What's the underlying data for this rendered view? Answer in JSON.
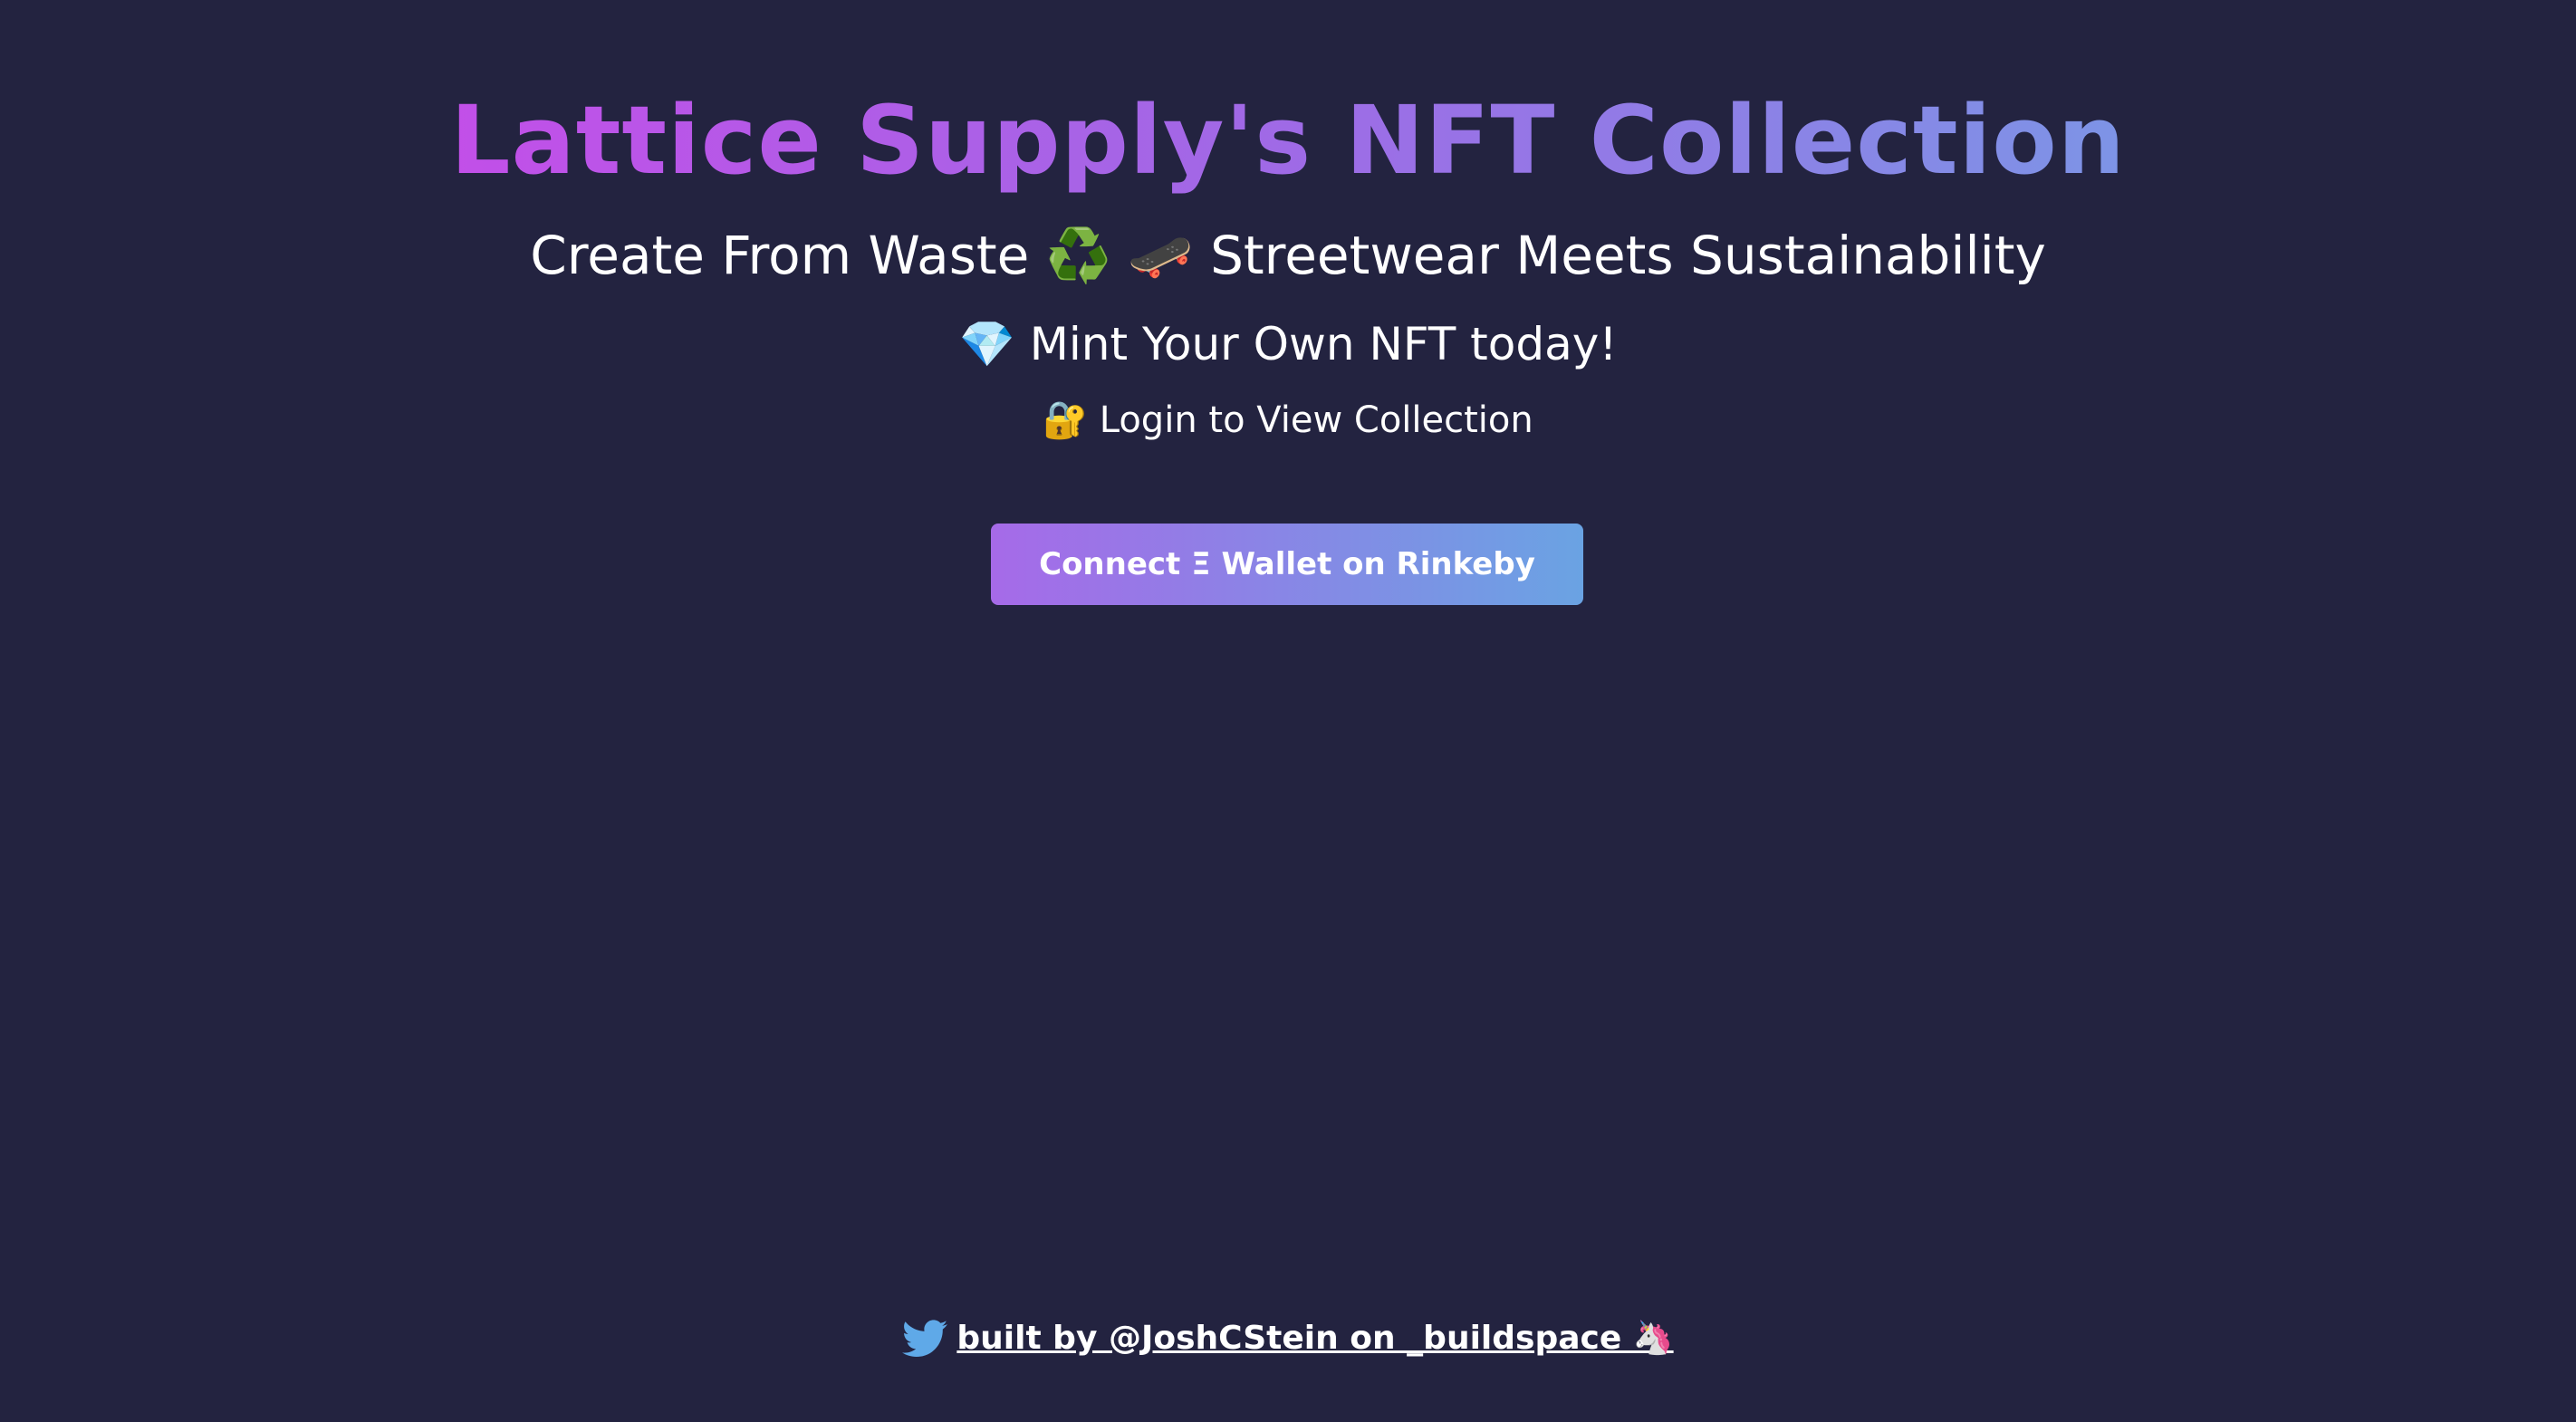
{
  "header": {
    "title": "Lattice Supply's NFT Collection",
    "subtitle": "Create From Waste ♻️ 🛹 Streetwear Meets Sustainability",
    "mint_text": "💎 Mint Your Own NFT today!",
    "login_text": "🔐 Login to View Collection"
  },
  "actions": {
    "connect_label": "Connect Ξ Wallet on Rinkeby"
  },
  "footer": {
    "icon": "twitter-icon",
    "link_text": "built by @JoshCStein on _buildspace 🦄"
  },
  "colors": {
    "background": "#232340",
    "title_gradient_start": "#c24fe8",
    "title_gradient_end": "#7d94e6",
    "button_gradient_start": "#a66ae8",
    "button_gradient_end": "#6aa3e3",
    "twitter_blue": "#5fa9e8"
  }
}
